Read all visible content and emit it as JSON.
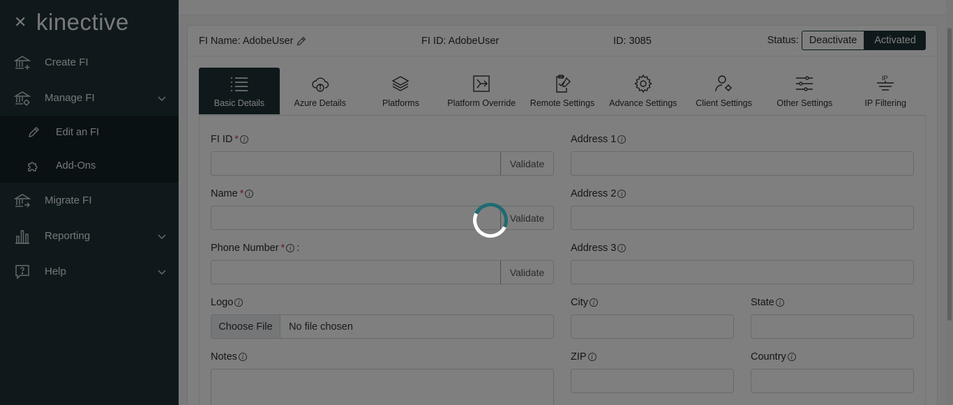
{
  "sidebar": {
    "logo": "kinective",
    "items": [
      {
        "label": "Create FI",
        "icon": "bank-plus-icon"
      },
      {
        "label": "Manage FI",
        "icon": "bank-gear-icon"
      },
      {
        "label": "Migrate FI",
        "icon": "bank-arrow-icon"
      },
      {
        "label": "Reporting",
        "icon": "bar-chart-icon"
      },
      {
        "label": "Help",
        "icon": "help-bubble-icon"
      }
    ],
    "sub_items": [
      {
        "label": "Edit an FI",
        "icon": "pencil-icon"
      },
      {
        "label": "Add-Ons",
        "icon": "puzzle-icon"
      }
    ]
  },
  "header": {
    "fi_name": "FI Name: AdobeUser",
    "fi_id": "FI ID: AdobeUser",
    "id": "ID: 3085",
    "status_label": "Status:",
    "deactivate": "Deactivate",
    "activated": "Activated"
  },
  "tabs": [
    {
      "label": "Basic Details",
      "icon": "list-icon"
    },
    {
      "label": "Azure Details",
      "icon": "cloud-info-icon"
    },
    {
      "label": "Platforms",
      "icon": "layers-icon"
    },
    {
      "label": "Platform Override",
      "icon": "override-arrow-icon"
    },
    {
      "label": "Remote Settings",
      "icon": "clipboard-check-icon"
    },
    {
      "label": "Advance Settings",
      "icon": "gear-icon"
    },
    {
      "label": "Client Settings",
      "icon": "user-gear-icon"
    },
    {
      "label": "Other Settings",
      "icon": "sliders-icon"
    },
    {
      "label": "IP Filtering",
      "icon": "ip-filter-icon"
    }
  ],
  "form": {
    "fi_id_label": "FI ID",
    "name_label": "Name",
    "phone_label": "Phone Number",
    "phone_suffix": ":",
    "logo_label": "Logo",
    "notes_label": "Notes",
    "address1_label": "Address 1",
    "address2_label": "Address 2",
    "address3_label": "Address 3",
    "city_label": "City",
    "state_label": "State",
    "zip_label": "ZIP",
    "country_label": "Country",
    "validate": "Validate",
    "choose_file": "Choose File",
    "no_file": "No file chosen",
    "required_mark": "*",
    "info_glyph": "i"
  },
  "colors": {
    "sidebar_bg": "#1f3236",
    "accent": "#1f6b73",
    "required": "#d23b3b"
  }
}
